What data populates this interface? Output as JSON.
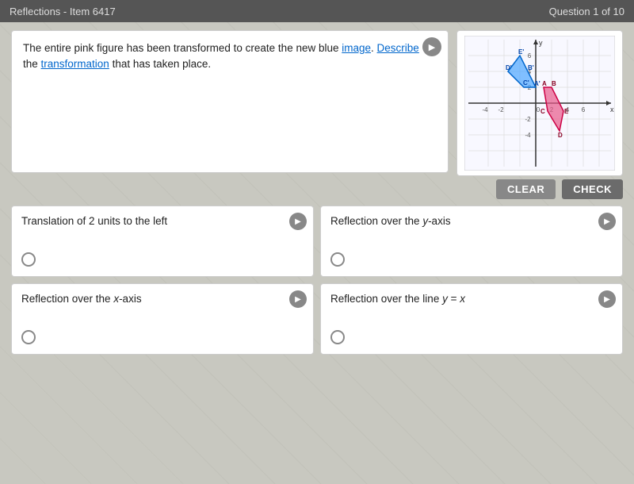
{
  "header": {
    "left_title": "Reflections - Item 6417",
    "right_title": "Question 1 of 10"
  },
  "question": {
    "text_part1": "The entire pink figure has been transformed to create the new blue ",
    "link_image": "image",
    "text_part2": ". ",
    "link_describe": "Describe",
    "text_part3": "\nthe ",
    "link_transformation": "transformation",
    "text_part4": " that has taken place.",
    "audio_label": "🔊"
  },
  "buttons": {
    "clear_label": "CLear",
    "check_label": "CHeCK"
  },
  "choices": [
    {
      "id": "choice-a",
      "text": "Translation of 2 units to the left",
      "audio_label": "🔊"
    },
    {
      "id": "choice-b",
      "text": "Reflection over the y-axis",
      "audio_label": "🔊"
    },
    {
      "id": "choice-c",
      "text": "Reflection over the x-axis",
      "audio_label": "🔊"
    },
    {
      "id": "choice-d",
      "text": "Reflection over the line y = x",
      "audio_label": "🔊"
    }
  ],
  "graph": {
    "alt": "Coordinate plane showing pink and blue quadrilaterals"
  }
}
